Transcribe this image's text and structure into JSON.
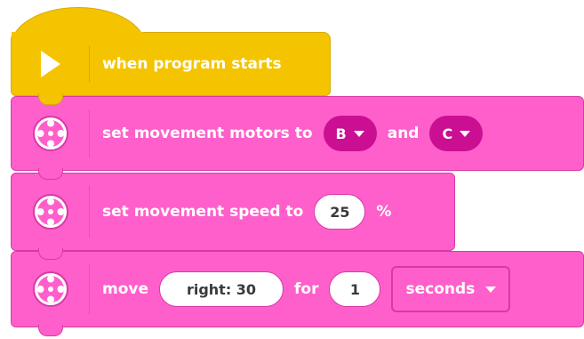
{
  "blocks": {
    "start": {
      "label": "when program starts",
      "icon": "play-icon"
    },
    "motors": {
      "label": "set movement motors to",
      "port1": "B",
      "connector": "and",
      "port2": "C",
      "icon": "motor-pair-icon"
    },
    "speed": {
      "label": "set movement speed to",
      "value": "25",
      "unit": "%",
      "icon": "motor-pair-icon"
    },
    "move": {
      "label": "move",
      "direction": "right: 30",
      "for_label": "for",
      "amount": "1",
      "unit": "seconds",
      "icon": "motor-pair-icon"
    }
  },
  "colors": {
    "event": "#f5c400",
    "motion": "#ff5fcb",
    "motion_dark": "#ca0f93"
  }
}
